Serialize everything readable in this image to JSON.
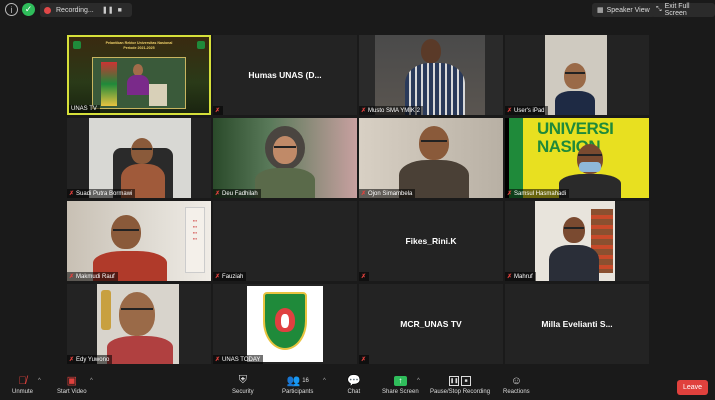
{
  "topbar": {
    "recording_label": "Recording...",
    "speaker_view_label": "Speaker View",
    "exit_full_screen_label": "Exit Full Screen"
  },
  "tiles": [
    {
      "name": "UNAS TV"
    },
    {
      "name": "",
      "display_name": "Humas UNAS  (D..."
    },
    {
      "name": "Musto SMA  YMIK 2"
    },
    {
      "name": "User's iPad"
    },
    {
      "name": "Suadi Putra Bormawi"
    },
    {
      "name": "Deu Fadhilah"
    },
    {
      "name": "Ojon Simambela"
    },
    {
      "name": "Samsul Hasmahadi"
    },
    {
      "name": "Makmudi Rauf"
    },
    {
      "name": "Fauziah"
    },
    {
      "name": "",
      "display_name": "Fikes_Rini.K"
    },
    {
      "name": "Mahruf"
    },
    {
      "name": "Edy Yuwono"
    },
    {
      "name": "UNAS TODAY"
    },
    {
      "name": "",
      "display_name": "MCR_UNAS TV"
    },
    {
      "name": "",
      "display_name": "Milla Evelianti S..."
    }
  ],
  "slide": {
    "title_line1": "Pelantikan Rektor Universitas Nasional",
    "title_line2": "Periode 2021-2025"
  },
  "bottombar": {
    "unmute": "Unmute",
    "start_video": "Start Video",
    "security": "Security",
    "participants": "Participants",
    "participants_count": "16",
    "chat": "Chat",
    "share_screen": "Share Screen",
    "pause_recording": "Pause/Stop Recording",
    "reactions": "Reactions",
    "leave": "Leave"
  },
  "colors": {
    "active_speaker_border": "#d6e03a",
    "muted_icon": "#e0413d",
    "share_green": "#2fbd5b",
    "leave_red": "#e0413d",
    "logo_green": "#1f8a3a"
  }
}
